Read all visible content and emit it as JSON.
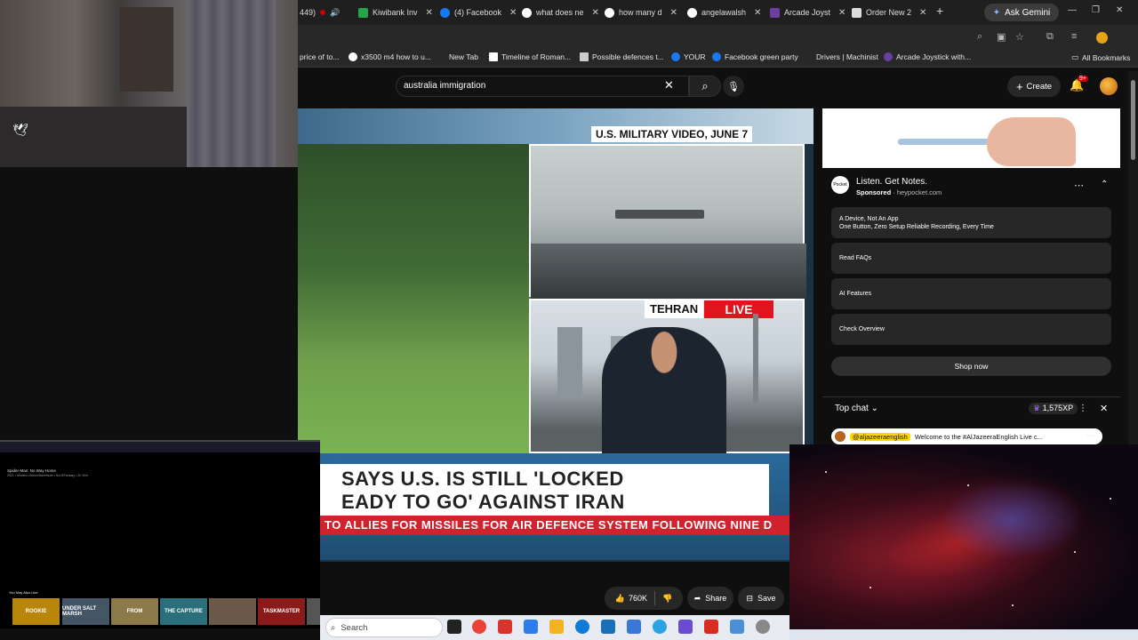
{
  "browser": {
    "tabs": [
      {
        "label": "449)",
        "color": "#cc0000"
      },
      {
        "label": "Kiwibank Inv",
        "color": "#25a449"
      },
      {
        "label": "(4) Facebook",
        "color": "#1877f2"
      },
      {
        "label": "what does ne",
        "color": "#4285f4"
      },
      {
        "label": "how many d",
        "color": "#4285f4"
      },
      {
        "label": "angelawalsh",
        "color": "#4285f4"
      },
      {
        "label": "Arcade Joyst",
        "color": "#6b3fa0"
      },
      {
        "label": "Order New 2",
        "color": "#444444"
      }
    ],
    "new_tab": "+",
    "ask_gemini": "Ask Gemini",
    "bookmarks": [
      {
        "label": "price of to...",
        "color": "#999999"
      },
      {
        "label": "x3500 m4 how to u...",
        "color": "#4285f4"
      },
      {
        "label": "New Tab",
        "color": "#777777"
      },
      {
        "label": "Timeline of Roman...",
        "color": "#ffffff"
      },
      {
        "label": "Possible defences t...",
        "color": "#888888"
      },
      {
        "label": "YOUR",
        "color": "#1877f2"
      },
      {
        "label": "Facebook green party",
        "color": "#1877f2"
      },
      {
        "label": "Drivers | Machinist",
        "color": "#444444"
      },
      {
        "label": "Arcade Joystick with...",
        "color": "#6b3fa0"
      }
    ],
    "all_bookmarks": "All Bookmarks"
  },
  "youtube": {
    "search_value": "australia immigration",
    "create_label": "Create",
    "notifications_badge": "9+"
  },
  "video": {
    "top_label": "U.S. MILITARY VIDEO, JUNE 7",
    "location_label": "TEHRAN",
    "live_label": "LIVE",
    "headline_line1": "SAYS U.S. IS STILL 'LOCKED",
    "headline_line2": "EADY TO GO' AGAINST IRAN",
    "crawl": "TO ALLIES FOR MISSILES FOR AIR DEFENCE SYSTEM FOLLOWING NINE D"
  },
  "actions": {
    "likes": "760K",
    "share": "Share",
    "save": "Save"
  },
  "ad": {
    "logo": "Pocket",
    "title": "Listen. Get Notes.",
    "sponsored": "Sponsored",
    "domain": "heypocket.com",
    "buttons": [
      {
        "title": "A Device, Not An App",
        "subtitle": "One Button, Zero Setup Reliable Recording, Every Time"
      },
      {
        "title": "Read FAQs",
        "subtitle": ""
      },
      {
        "title": "AI Features",
        "subtitle": ""
      },
      {
        "title": "Check Overview",
        "subtitle": ""
      }
    ],
    "shop_now": "Shop now"
  },
  "chat": {
    "title": "Top chat",
    "xp": "1,575XP",
    "message_user": "@aljazeeraenglish",
    "message_text": "Welcome to the #AlJazeeraEnglish Live c..."
  },
  "mini_screen": {
    "title": "Spider-Man: No Way Home",
    "subtitle": "2021 • Movies • Action/Adventure • Sci-fi/Fantasy • 2h 30m",
    "you_may_like": "You May Also Like",
    "posters": [
      {
        "label": "ROOKIE",
        "color": "#b8860b"
      },
      {
        "label": "UNDER SALT MARSH",
        "color": "#445566"
      },
      {
        "label": "FROM",
        "color": "#8c7a4a"
      },
      {
        "label": "THE CAPTURE",
        "color": "#2a6f7a"
      },
      {
        "label": "",
        "color": "#6b5a4a"
      },
      {
        "label": "TASKMASTER",
        "color": "#8b1a1a"
      },
      {
        "label": "",
        "color": "#555555"
      }
    ]
  },
  "taskbar": {
    "search": "Search",
    "apps": [
      "#222222",
      "#ea4335",
      "#d9342b",
      "#2b7de9",
      "#f3b220",
      "#0f7bd6",
      "#1b6fb7",
      "#3a78d8",
      "#2aa3e5",
      "#6b4bd1",
      "#d92d20",
      "#4a90d9",
      "#888888"
    ]
  }
}
